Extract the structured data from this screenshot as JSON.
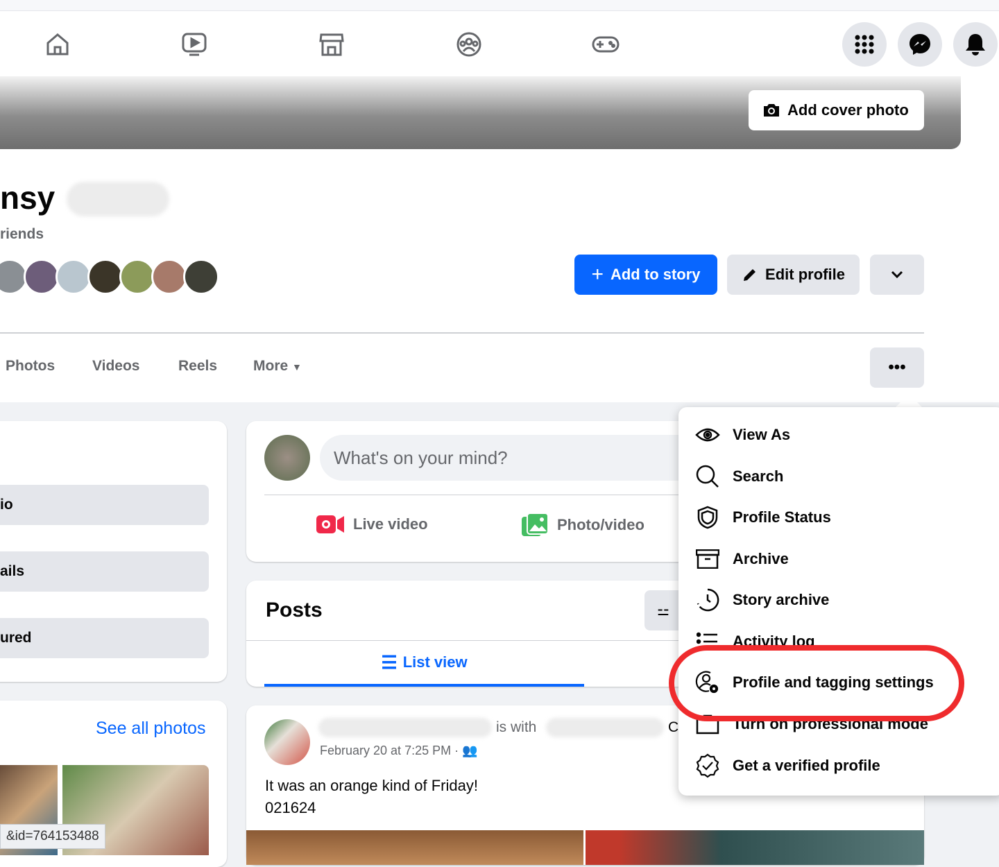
{
  "nav": {
    "icons": [
      "home-icon",
      "watch-icon",
      "marketplace-icon",
      "groups-icon",
      "gaming-icon"
    ],
    "right": [
      "menu-grid-icon",
      "messenger-icon",
      "notifications-icon"
    ]
  },
  "cover": {
    "add_cover_label": "Add cover photo"
  },
  "profile": {
    "name_partial": "nsy",
    "friends_partial": "riends",
    "add_story_label": "Add to story",
    "edit_profile_label": "Edit profile"
  },
  "tabs": [
    "Photos",
    "Videos",
    "Reels",
    "More"
  ],
  "left": {
    "pills": [
      "io",
      "ails",
      "ured"
    ],
    "see_all_photos": "See all photos"
  },
  "composer": {
    "placeholder": "What's on your mind?",
    "live_video": "Live video",
    "photo_video": "Photo/video"
  },
  "posts": {
    "title": "Posts",
    "list_view": "List view"
  },
  "post": {
    "is_with": "is with",
    "trailing": "C",
    "timestamp": "February 20 at 7:25 PM ·",
    "text_line1": "It was an orange kind of Friday!",
    "text_line2": "021624"
  },
  "status_url": "&id=764153488",
  "menu": {
    "items": [
      "View As",
      "Search",
      "Profile Status",
      "Archive",
      "Story archive",
      "Activity log",
      "Profile and tagging settings",
      "Turn on professional mode",
      "Get a verified profile"
    ]
  },
  "colors": {
    "accent": "#0866ff",
    "highlight": "#ef2b2d"
  }
}
